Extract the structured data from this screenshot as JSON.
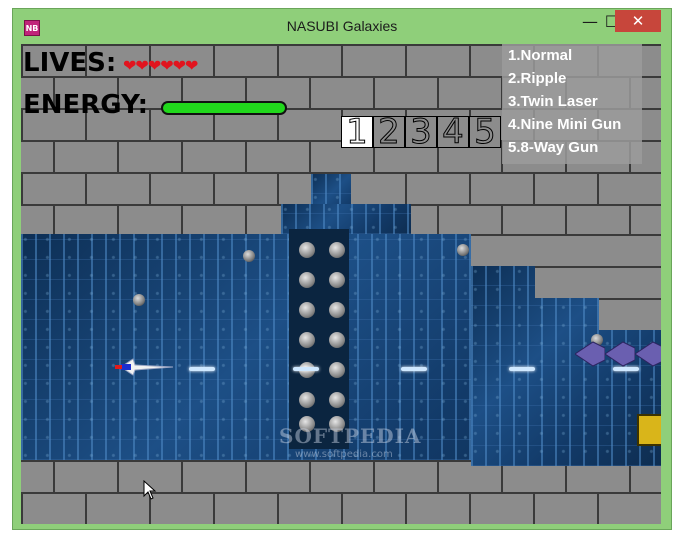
{
  "window": {
    "title": "NASUBI Galaxies",
    "icon_label": "NB",
    "minimize_icon": "minimize-icon",
    "maximize_icon": "maximize-icon",
    "close_icon": "close-icon"
  },
  "hud": {
    "lives_label": "LIVES:",
    "lives_hearts": "❤❤❤❤❤❤",
    "lives_count": 6,
    "energy_label": "ENERGY:",
    "energy_fraction": 1.0
  },
  "weapon_slots": [
    {
      "label": "1",
      "active": true
    },
    {
      "label": "2",
      "active": false
    },
    {
      "label": "3",
      "active": false
    },
    {
      "label": "4",
      "active": false
    },
    {
      "label": "5",
      "active": false
    }
  ],
  "weapon_list": [
    "1.Normal",
    "2.Ripple",
    "3.Twin Laser",
    "4.Nine Mini Gun",
    "5.8-Way Gun"
  ],
  "watermark": {
    "main": "SOFTPEDIA",
    "sub": "www.softpedia.com"
  },
  "colors": {
    "frame": "#8fcf7a",
    "close_button": "#c7463b",
    "brick": "#8c8c8c",
    "energy": "#21d81c",
    "heart": "#e1141e"
  }
}
